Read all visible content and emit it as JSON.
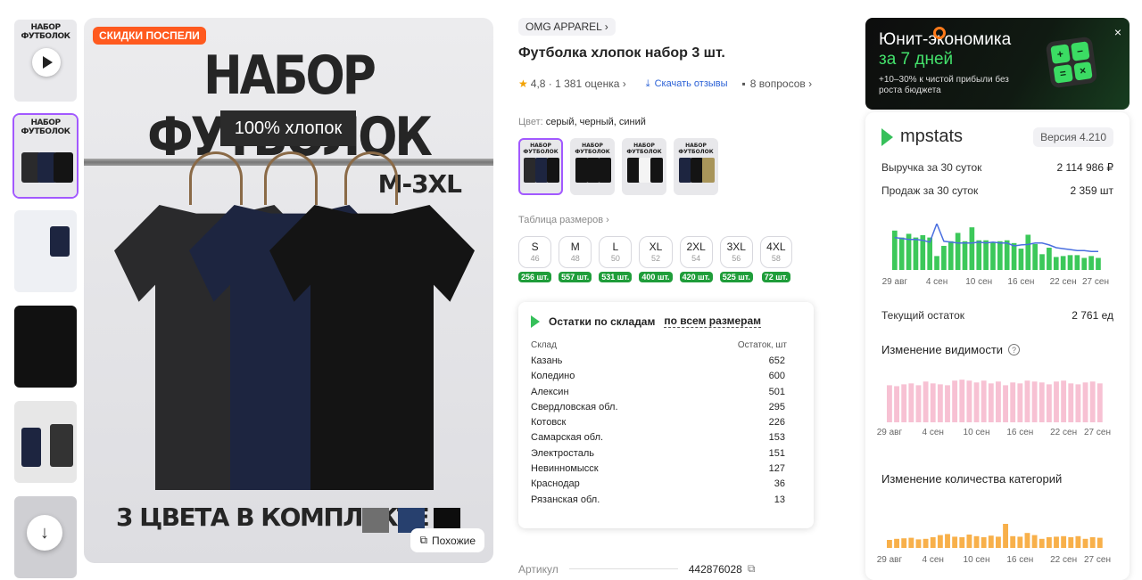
{
  "gallery": {
    "thumb_title": "НАБОР ФУТБОЛОК",
    "badge": "СКИДКИ ПОСПЕЛИ",
    "hero_title": "НАБОР ФУТБОЛОК",
    "cotton_label": "100% хлопок",
    "size_range": "M-3XL",
    "colors_caption": "3 ЦВЕТА В КОМПЛЕКТЕ",
    "similar_label": "Похожие"
  },
  "product": {
    "brand": "OMG APPAREL",
    "title": "Футболка хлопок набор 3 шт.",
    "rating": "4,8",
    "reviews": "1 381 оценка",
    "download_reviews": "Скачать отзывы",
    "questions": "8 вопросов",
    "color_label": "Цвет:",
    "color_value": "серый, черный, синий",
    "variant_title": "НАБОР ФУТБОЛОК",
    "size_table": "Таблица размеров",
    "sizes": [
      {
        "size": "S",
        "ru": "46",
        "stock": "256 шт."
      },
      {
        "size": "M",
        "ru": "48",
        "stock": "557 шт."
      },
      {
        "size": "L",
        "ru": "50",
        "stock": "531 шт."
      },
      {
        "size": "XL",
        "ru": "52",
        "stock": "400 шт."
      },
      {
        "size": "2XL",
        "ru": "54",
        "stock": "420 шт."
      },
      {
        "size": "3XL",
        "ru": "56",
        "stock": "525 шт."
      },
      {
        "size": "4XL",
        "ru": "58",
        "stock": "72 шт."
      }
    ],
    "article_label": "Артикул",
    "article_value": "442876028"
  },
  "warehouses": {
    "title": "Остатки по складам",
    "filter": "по всем размерам",
    "col_name": "Склад",
    "col_qty": "Остаток, шт",
    "rows": [
      {
        "name": "Казань",
        "qty": "652"
      },
      {
        "name": "Коледино",
        "qty": "600"
      },
      {
        "name": "Алексин",
        "qty": "501"
      },
      {
        "name": "Свердловская обл.",
        "qty": "295"
      },
      {
        "name": "Котовск",
        "qty": "226"
      },
      {
        "name": "Самарская обл.",
        "qty": "153"
      },
      {
        "name": "Электросталь",
        "qty": "151"
      },
      {
        "name": "Невинномысск",
        "qty": "127"
      },
      {
        "name": "Краснодар",
        "qty": "36"
      },
      {
        "name": "Рязанская обл.",
        "qty": "13"
      }
    ]
  },
  "ad": {
    "line1": "Юнит-экономика",
    "line2": "за 7 дней",
    "line3": "+10–30% к чистой прибыли без роста бюджета",
    "close": "×"
  },
  "mpstats": {
    "logo": "mpstats",
    "version": "Версия 4.210",
    "revenue_label": "Выручка за 30 суток",
    "revenue_value": "2 114 986 ₽",
    "sales_label": "Продаж за 30 суток",
    "sales_value": "2 359 шт",
    "stock_label": "Текущий остаток",
    "stock_value": "2 761 ед",
    "visibility_title": "Изменение видимости",
    "categories_title": "Изменение количества категорий"
  },
  "chart_data": [
    {
      "type": "bar",
      "name": "sales",
      "categories": [
        "29 авг",
        "30 авг",
        "31 авг",
        "1 сен",
        "2 сен",
        "3 сен",
        "4 сен",
        "5 сен",
        "6 сен",
        "7 сен",
        "8 сен",
        "9 сен",
        "10 сен",
        "11 сен",
        "12 сен",
        "13 сен",
        "14 сен",
        "15 сен",
        "16 сен",
        "17 сен",
        "18 сен",
        "19 сен",
        "20 сен",
        "21 сен",
        "22 сен",
        "23 сен",
        "24 сен",
        "25 сен",
        "26 сен",
        "27 сен"
      ],
      "values": [
        85,
        70,
        78,
        70,
        75,
        70,
        30,
        52,
        62,
        80,
        62,
        92,
        64,
        64,
        60,
        62,
        64,
        58,
        46,
        76,
        56,
        34,
        48,
        28,
        30,
        32,
        32,
        26,
        30,
        26
      ],
      "line_values": [
        70,
        68,
        66,
        66,
        64,
        60,
        100,
        62,
        60,
        58,
        58,
        58,
        60,
        58,
        60,
        58,
        58,
        52,
        54,
        55,
        58,
        58,
        54,
        48,
        46,
        44,
        42,
        42,
        40,
        40
      ],
      "tick_labels": [
        "29 авг",
        "4 сен",
        "10 сен",
        "16 сен",
        "22 сен",
        "27 сен"
      ],
      "colors": {
        "bar": "#3cc85a",
        "line": "#4a6fe0"
      }
    },
    {
      "type": "bar",
      "name": "visibility",
      "categories": [
        "29 авг",
        "30 авг",
        "31 авг",
        "1 сен",
        "2 сен",
        "3 сен",
        "4 сен",
        "5 сен",
        "6 сен",
        "7 сен",
        "8 сен",
        "9 сен",
        "10 сен",
        "11 сен",
        "12 сен",
        "13 сен",
        "14 сен",
        "15 сен",
        "16 сен",
        "17 сен",
        "18 сен",
        "19 сен",
        "20 сен",
        "21 сен",
        "22 сен",
        "23 сен",
        "24 сен",
        "25 сен",
        "26 сен",
        "27 сен"
      ],
      "values": [
        80,
        78,
        82,
        84,
        80,
        88,
        84,
        82,
        80,
        90,
        92,
        90,
        86,
        90,
        84,
        88,
        80,
        86,
        84,
        90,
        88,
        86,
        82,
        88,
        90,
        84,
        82,
        86,
        88,
        84
      ],
      "tick_labels": [
        "29 авг",
        "4 сен",
        "10 сен",
        "16 сен",
        "22 сен",
        "27 сен"
      ],
      "colors": {
        "bar": "#f7c1d3"
      }
    },
    {
      "type": "bar",
      "name": "categories",
      "categories": [
        "29 авг",
        "30 авг",
        "31 авг",
        "1 сен",
        "2 сен",
        "3 сен",
        "4 сен",
        "5 сен",
        "6 сен",
        "7 сен",
        "8 сен",
        "9 сен",
        "10 сен",
        "11 сен",
        "12 сен",
        "13 сен",
        "14 сен",
        "15 сен",
        "16 сен",
        "17 сен",
        "18 сен",
        "19 сен",
        "20 сен",
        "21 сен",
        "22 сен",
        "23 сен",
        "24 сен",
        "25 сен",
        "26 сен",
        "27 сен"
      ],
      "values": [
        30,
        34,
        36,
        38,
        32,
        34,
        40,
        48,
        52,
        42,
        40,
        50,
        44,
        40,
        46,
        42,
        90,
        44,
        42,
        56,
        48,
        34,
        40,
        42,
        44,
        40,
        44,
        34,
        40,
        38
      ],
      "tick_labels": [
        "29 авг",
        "4 сен",
        "10 сен",
        "16 сен",
        "22 сен",
        "27 сен"
      ],
      "colors": {
        "bar": "#f8b04a"
      }
    }
  ]
}
